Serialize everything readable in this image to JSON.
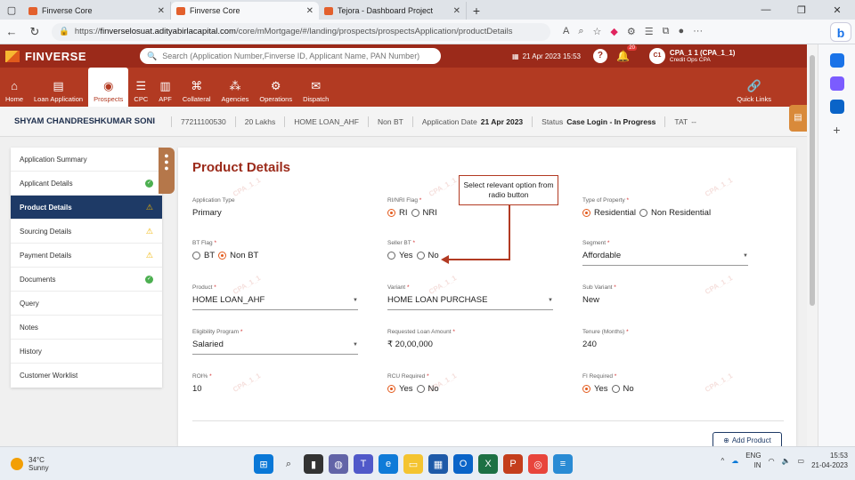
{
  "browser": {
    "tabs": [
      {
        "title": "Finverse Core",
        "active": false
      },
      {
        "title": "Finverse Core",
        "active": true
      },
      {
        "title": "Tejora - Dashboard Project",
        "active": false
      }
    ],
    "url_prefix": "https://",
    "url_host": "finverselosuat.adityabirlacapital.com",
    "url_path": "/core/mMortgage/#/landing/prospects/prospectsApplication/productDetails"
  },
  "header": {
    "brand": "FINVERSE",
    "search_placeholder": "Search (Application Number,Finverse ID, Applicant Name, PAN Number)",
    "datetime": "21 Apr 2023 15:53",
    "notif_count": "20",
    "user_initials": "C1",
    "user_name": "CPA_1 1 (CPA_1_1)",
    "user_role": "Credit Ops CPA"
  },
  "nav": {
    "items": [
      {
        "label": "Home",
        "icon": "home-icon"
      },
      {
        "label": "Loan Application",
        "icon": "document-icon"
      },
      {
        "label": "Prospects",
        "icon": "user-icon"
      },
      {
        "label": "CPC",
        "icon": "stack-icon"
      },
      {
        "label": "APF",
        "icon": "building-icon"
      },
      {
        "label": "Collateral",
        "icon": "collateral-icon"
      },
      {
        "label": "Agencies",
        "icon": "agencies-icon"
      },
      {
        "label": "Operations",
        "icon": "gear-icon"
      },
      {
        "label": "Dispatch",
        "icon": "dispatch-icon"
      }
    ],
    "quick_links": "Quick Links"
  },
  "summary": {
    "name": "SHYAM CHANDRESHKUMAR SONI",
    "app_no": "77211100530",
    "amount": "20 Lakhs",
    "product": "HOME LOAN_AHF",
    "bt": "Non BT",
    "app_date_label": "Application Date",
    "app_date": "21 Apr 2023",
    "status_label": "Status",
    "status": "Case Login - In Progress",
    "tat_label": "TAT",
    "tat": "--"
  },
  "menu": [
    {
      "label": "Application Summary",
      "status": ""
    },
    {
      "label": "Applicant Details",
      "status": "ok"
    },
    {
      "label": "Product Details",
      "status": "warn"
    },
    {
      "label": "Sourcing Details",
      "status": "warn"
    },
    {
      "label": "Payment Details",
      "status": "warn"
    },
    {
      "label": "Documents",
      "status": "ok"
    },
    {
      "label": "Query",
      "status": ""
    },
    {
      "label": "Notes",
      "status": ""
    },
    {
      "label": "History",
      "status": ""
    },
    {
      "label": "Customer Worklist",
      "status": ""
    }
  ],
  "content": {
    "title": "Product Details",
    "application_type": {
      "label": "Application Type",
      "value": "Primary"
    },
    "ri_nri": {
      "label": "RI/NRI Flag",
      "options": [
        "RI",
        "NRI"
      ],
      "selected": "RI"
    },
    "property_type": {
      "label": "Type of Property",
      "options": [
        "Residential",
        "Non Residential"
      ],
      "selected": "Residential"
    },
    "bt_flag": {
      "label": "BT Flag",
      "options": [
        "BT",
        "Non BT"
      ],
      "selected": "Non BT"
    },
    "seller_bt": {
      "label": "Seller BT",
      "options": [
        "Yes",
        "No"
      ],
      "selected": ""
    },
    "segment": {
      "label": "Segment",
      "value": "Affordable"
    },
    "product": {
      "label": "Product",
      "value": "HOME LOAN_AHF"
    },
    "variant": {
      "label": "Variant",
      "value": "HOME LOAN PURCHASE"
    },
    "sub_variant": {
      "label": "Sub Variant",
      "value": "New"
    },
    "eligibility": {
      "label": "Eligibility Program",
      "value": "Salaried"
    },
    "loan_amount": {
      "label": "Requested Loan Amount",
      "value": "₹ 20,00,000"
    },
    "tenure": {
      "label": "Tenure (Months)",
      "value": "240"
    },
    "roi": {
      "label": "ROI%",
      "value": "10"
    },
    "rcu": {
      "label": "RCU Required",
      "options": [
        "Yes",
        "No"
      ],
      "selected": "Yes"
    },
    "fi": {
      "label": "FI Required",
      "options": [
        "Yes",
        "No"
      ],
      "selected": "Yes"
    },
    "add_product": "Add Product",
    "callout": "Select relevant option from radio button",
    "watermark": "CPA_1_1"
  },
  "taskbar": {
    "temp": "34°C",
    "weather": "Sunny",
    "lang": "ENG",
    "region": "IN",
    "time": "15:53",
    "date": "21-04-2023"
  }
}
